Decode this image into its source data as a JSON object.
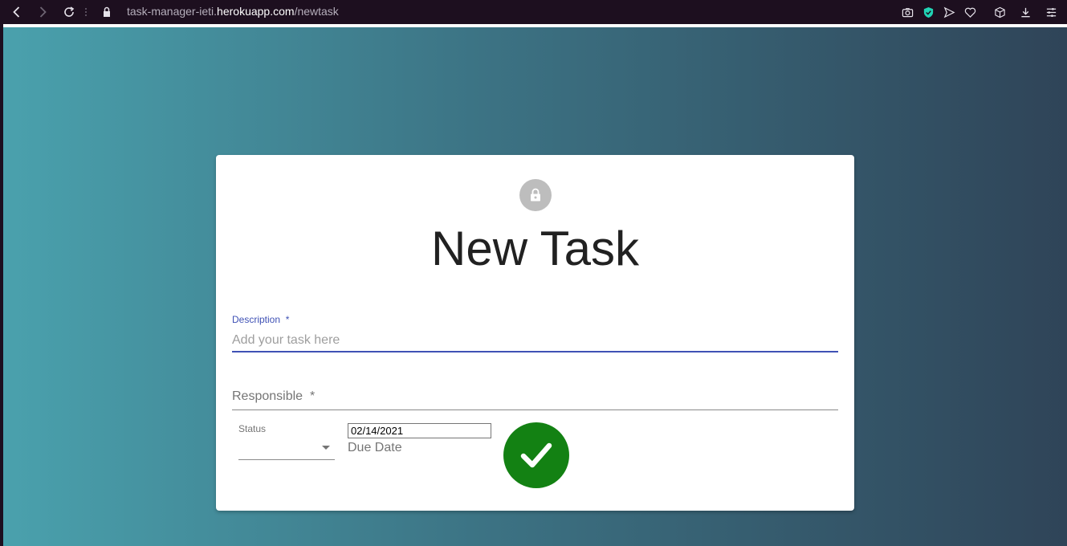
{
  "browser": {
    "url_prefix": "task-manager-ieti.",
    "url_domain": "herokuapp.com",
    "url_path": "/newtask",
    "icons": [
      "back-icon",
      "forward-icon",
      "reload-icon",
      "lock-icon",
      "camera-icon",
      "shield-icon",
      "send-icon",
      "heart-icon",
      "cube-icon",
      "download-icon",
      "menu-icon"
    ]
  },
  "form": {
    "title": "New Task",
    "description": {
      "label": "Description",
      "required_mark": "*",
      "placeholder": "Add your task here"
    },
    "responsible": {
      "label": "Responsible",
      "required_mark": "*"
    },
    "status": {
      "label": "Status"
    },
    "due_date": {
      "value": "02/14/2021",
      "label": "Due Date"
    }
  },
  "colors": {
    "accent": "#3f51b5",
    "submit": "#138113",
    "avatar": "#bdbdbd"
  }
}
